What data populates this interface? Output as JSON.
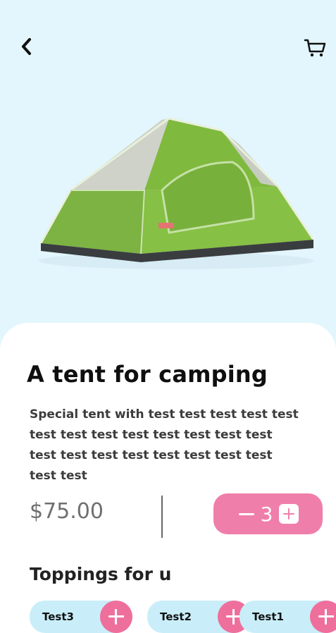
{
  "header": {
    "back_icon": "chevron-left-icon",
    "cart_icon": "cart-icon"
  },
  "product": {
    "image": "tent-image",
    "title": "A tent for camping",
    "description": "Special tent with test test test test test test test test test test test test test test test test test test test test test test test",
    "price": "$75.00",
    "quantity": "3"
  },
  "toppings": {
    "title": "Toppings for u",
    "items": [
      {
        "label": "Test3"
      },
      {
        "label": "Test2"
      },
      {
        "label": "Test1"
      }
    ]
  },
  "colors": {
    "background": "#e3f6fd",
    "accent_pink": "#f07eaa",
    "chip_blue": "#c9eef9",
    "tent_green": "#7cb342"
  }
}
